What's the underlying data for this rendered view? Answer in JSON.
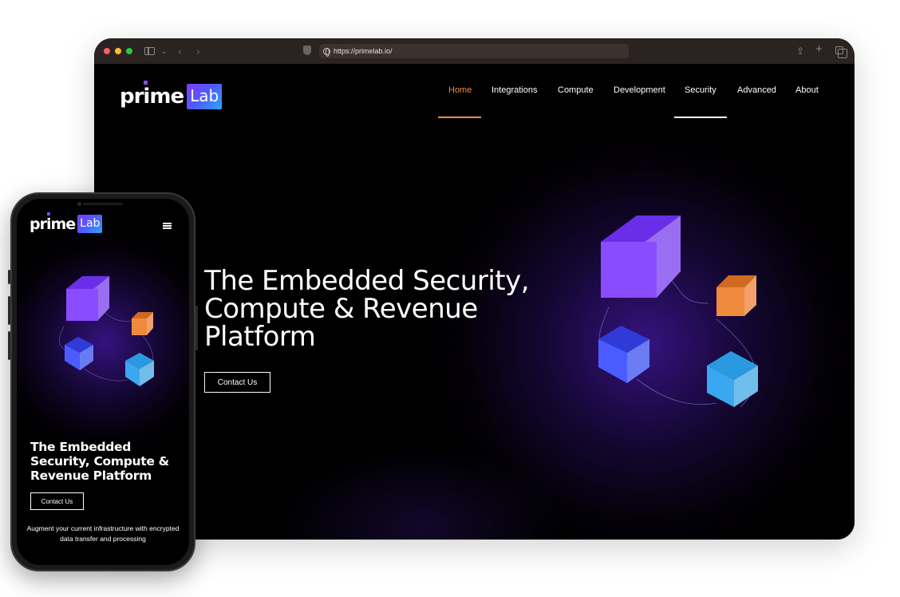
{
  "browser": {
    "url": "https://primelab.io/"
  },
  "logo": {
    "prime": "prime",
    "lab": "Lab"
  },
  "nav": {
    "items": [
      {
        "label": "Home",
        "active": true
      },
      {
        "label": "Integrations",
        "active": false
      },
      {
        "label": "Compute",
        "active": false
      },
      {
        "label": "Development",
        "active": false
      },
      {
        "label": "Security",
        "active": false
      },
      {
        "label": "Advanced",
        "active": false
      },
      {
        "label": "About",
        "active": false
      }
    ]
  },
  "hero": {
    "title_lines": [
      "The Embedded Security,",
      "Compute & Revenue",
      "Platform"
    ],
    "cta_label": "Contact Us"
  },
  "mobile": {
    "title_lines": [
      "The Embedded",
      "Security, Compute &",
      "Revenue Platform"
    ],
    "cta_label": "Contact Us",
    "subtitle": "Augment your current infrastructure with encrypted data transfer and processing"
  },
  "colors": {
    "accent_orange": "#f08a4b",
    "cube_purple": "#8a4cff",
    "cube_orange": "#f08a3c",
    "cube_blue": "#4a5cff",
    "cube_cyan": "#3aa8f0",
    "background": "#000000"
  }
}
